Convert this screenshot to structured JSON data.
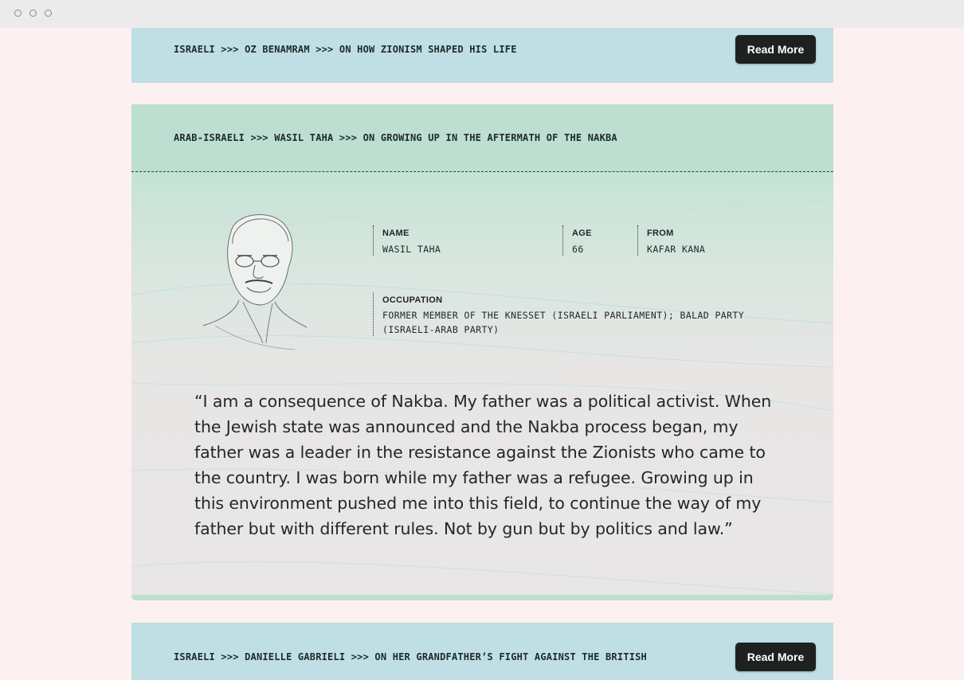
{
  "window": {
    "controls": [
      "close",
      "minimize",
      "zoom"
    ]
  },
  "cards": {
    "top": {
      "breadcrumb": "ISRAELI >>> OZ BENAMRAM >>> ON HOW ZIONISM SHAPED HIS LIFE",
      "button_label": "Read More"
    },
    "main": {
      "breadcrumb": "ARAB-ISRAELI >>> WASIL TAHA >>> ON GROWING UP IN THE AFTERMATH OF THE NAKBA",
      "name_label": "NAME",
      "name_value": "WASIL TAHA",
      "age_label": "AGE",
      "age_value": "66",
      "from_label": "FROM",
      "from_value": "KAFAR KANA",
      "occupation_label": "OCCUPATION",
      "occupation_value": "FORMER MEMBER OF THE KNESSET (ISRAELI PARLIAMENT); BALAD PARTY (ISRAELI-ARAB PARTY)",
      "quote": "“I am a consequence of Nakba. My father was a political activist. When the Jewish state was announced and the Nakba process began, my father was a leader in the resistance against the Zionists who came to the country. I was born while my father was a refugee. Growing up in this environment pushed me into this field, to continue the way of my father but with different rules. Not by gun but by politics and law.”"
    },
    "bottom": {
      "breadcrumb": "ISRAELI >>> DANIELLE GABRIELI >>> ON HER GRANDFATHER’S FIGHT AGAINST THE BRITISH",
      "button_label": "Read More"
    }
  },
  "colors": {
    "page_bg": "#fcf1f0",
    "blue_card": "#bfdfe4",
    "green_card": "#bcdfd1",
    "button_bg": "#1f2121"
  },
  "icons": {
    "portrait": "portrait-illustration"
  }
}
